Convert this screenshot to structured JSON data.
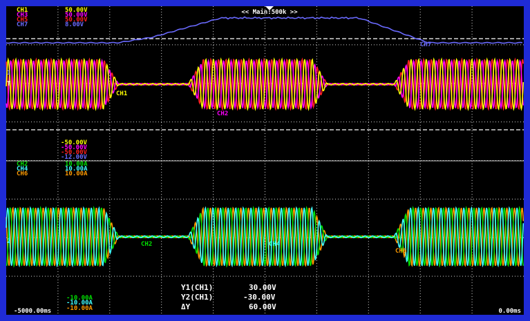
{
  "timebase_label": "<< Main:500k >>",
  "colors": {
    "frame": "#1f2bd6",
    "background": "#000000",
    "grid": "#d8d8d8",
    "ch1": "#ffff00",
    "ch2": "#00e000",
    "ch3": "#ff00ff",
    "ch4": "#40ffff",
    "ch5": "#ff2020",
    "ch6": "#ff9a00",
    "ch7": "#6a6aff"
  },
  "upper_scale": {
    "top": [
      {
        "name": "CH1",
        "value": "50.00V",
        "color": "#ffff00"
      },
      {
        "name": "CH3",
        "value": "50.00V",
        "color": "#ff00ff"
      },
      {
        "name": "CH5",
        "value": "50.00V",
        "color": "#ff2020"
      },
      {
        "name": "CH7",
        "value": "8.00V",
        "color": "#6a6aff"
      }
    ],
    "bottom": [
      {
        "value": "-50.00V",
        "color": "#ffff00"
      },
      {
        "value": "-50.00V",
        "color": "#ff00ff"
      },
      {
        "value": "-50.00V",
        "color": "#ff2020"
      },
      {
        "value": "-12.00V",
        "color": "#6a6aff"
      }
    ]
  },
  "lower_scale": {
    "top": [
      {
        "name": "CH2",
        "value": "10.00A",
        "color": "#00e000"
      },
      {
        "name": "CH4",
        "value": "10.00A",
        "color": "#40ffff"
      },
      {
        "name": "CH6",
        "value": "10.00A",
        "color": "#ff9a00"
      }
    ],
    "bottom": [
      {
        "value": "-10.00A",
        "color": "#00e000"
      },
      {
        "value": "-10.00A",
        "color": "#40ffff"
      },
      {
        "value": "-10.00A",
        "color": "#ff9a00"
      }
    ]
  },
  "trace_labels": {
    "ch1": "CH1",
    "ch2_upper": "CH2",
    "ch7": "CH7",
    "ch2_lower": "CH2",
    "ch4_lower": "CH4",
    "ch6_lower": "CH6"
  },
  "cursor_readout": {
    "y1_label": "Y1(CH1)",
    "y1_value": "30.00V",
    "y2_label": "Y2(CH1)",
    "y2_value": "-30.00V",
    "dy_label": "ΔY",
    "dy_value": "60.00V"
  },
  "time_axis": {
    "start": "-5000.00ms",
    "end": "0.00ms"
  },
  "markers": {
    "trigger": "T",
    "ground_upper": "1",
    "ground_lower": "2"
  }
}
